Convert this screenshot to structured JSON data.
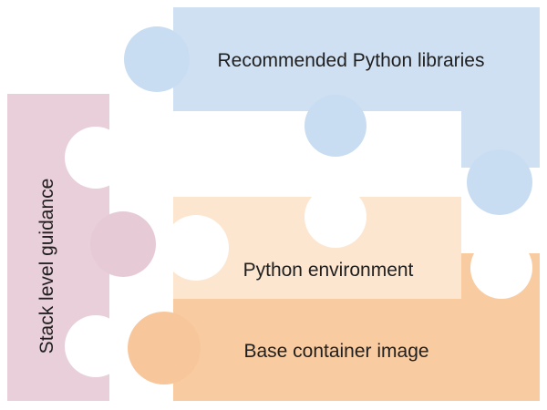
{
  "diagram": {
    "pieces": [
      {
        "id": "recommended-libraries",
        "label": "Recommended Python libraries",
        "color": "#cfe0f3",
        "tab_color": "#c8ddf1"
      },
      {
        "id": "python-environment",
        "label": "Python environment",
        "color": "#fde6cf",
        "tab_color": "#fde6cf"
      },
      {
        "id": "base-image",
        "label": "Base container image",
        "color": "#f8cba1",
        "tab_color": "#f7c79b"
      },
      {
        "id": "stack-guidance",
        "label": "Stack level guidance",
        "color": "#e8cfd9",
        "tab_color": "#e6cbd6"
      }
    ]
  }
}
